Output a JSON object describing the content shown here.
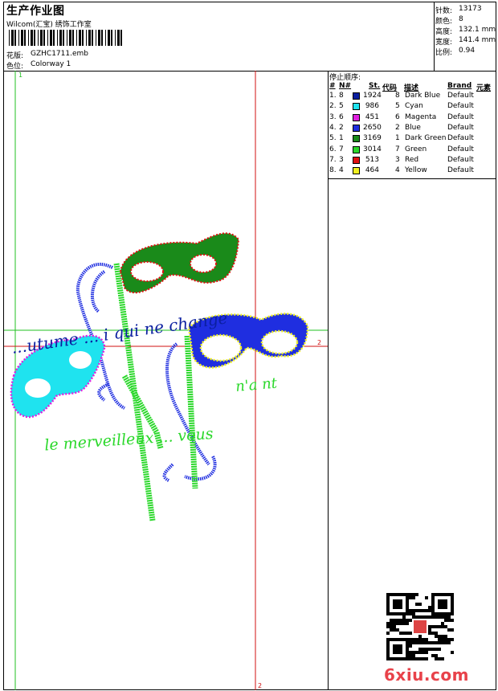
{
  "header": {
    "title": "生产作业图",
    "studio": "Wilcom(汇宝) 绣饰工作室",
    "design_label": "花版:",
    "design_value": "GZHC1711.emb",
    "colorway_label": "色位:",
    "colorway_value": "Colorway 1"
  },
  "stats": [
    {
      "label": "针数:",
      "value": "13173"
    },
    {
      "label": "颜色:",
      "value": "8"
    },
    {
      "label": "高度:",
      "value": "132.1 mm"
    },
    {
      "label": "宽度:",
      "value": "141.4 mm"
    },
    {
      "label": "比例:",
      "value": "0.94"
    }
  ],
  "stop_sequence": {
    "title": "停止顺序:",
    "columns": [
      "#",
      "N#",
      "St.",
      "代码",
      "描述",
      "Brand",
      "元素"
    ],
    "rows": [
      {
        "idx": "1.",
        "n": "8",
        "color": "#0b1fa0",
        "stitches": "1924",
        "code": "8",
        "desc": "Dark Blue",
        "brand": "Default"
      },
      {
        "idx": "2.",
        "n": "5",
        "color": "#1fe3ef",
        "stitches": "986",
        "code": "5",
        "desc": "Cyan",
        "brand": "Default"
      },
      {
        "idx": "3.",
        "n": "6",
        "color": "#e020e0",
        "stitches": "451",
        "code": "6",
        "desc": "Magenta",
        "brand": "Default"
      },
      {
        "idx": "4.",
        "n": "2",
        "color": "#1f2ee0",
        "stitches": "2650",
        "code": "2",
        "desc": "Blue",
        "brand": "Default"
      },
      {
        "idx": "5.",
        "n": "1",
        "color": "#1a8a1a",
        "stitches": "3169",
        "code": "1",
        "desc": "Dark Green",
        "brand": "Default"
      },
      {
        "idx": "6.",
        "n": "7",
        "color": "#2bd82b",
        "stitches": "3014",
        "code": "7",
        "desc": "Green",
        "brand": "Default"
      },
      {
        "idx": "7.",
        "n": "3",
        "color": "#e01010",
        "stitches": "513",
        "code": "3",
        "desc": "Red",
        "brand": "Default"
      },
      {
        "idx": "8.",
        "n": "4",
        "color": "#f0f020",
        "stitches": "464",
        "code": "4",
        "desc": "Yellow",
        "brand": "Default"
      }
    ]
  },
  "canvas": {
    "marker_1": "1",
    "marker_2_right": "2",
    "marker_2_bottom": "2",
    "text_blue": "...utume ... i qui ne change",
    "text_green_1": "n'a nt",
    "text_green_2": "le merveilleux ... vous"
  },
  "watermark": {
    "text": "6xiu.com"
  },
  "colors": {
    "guide_green": "#20c020",
    "guide_red": "#d01010"
  }
}
